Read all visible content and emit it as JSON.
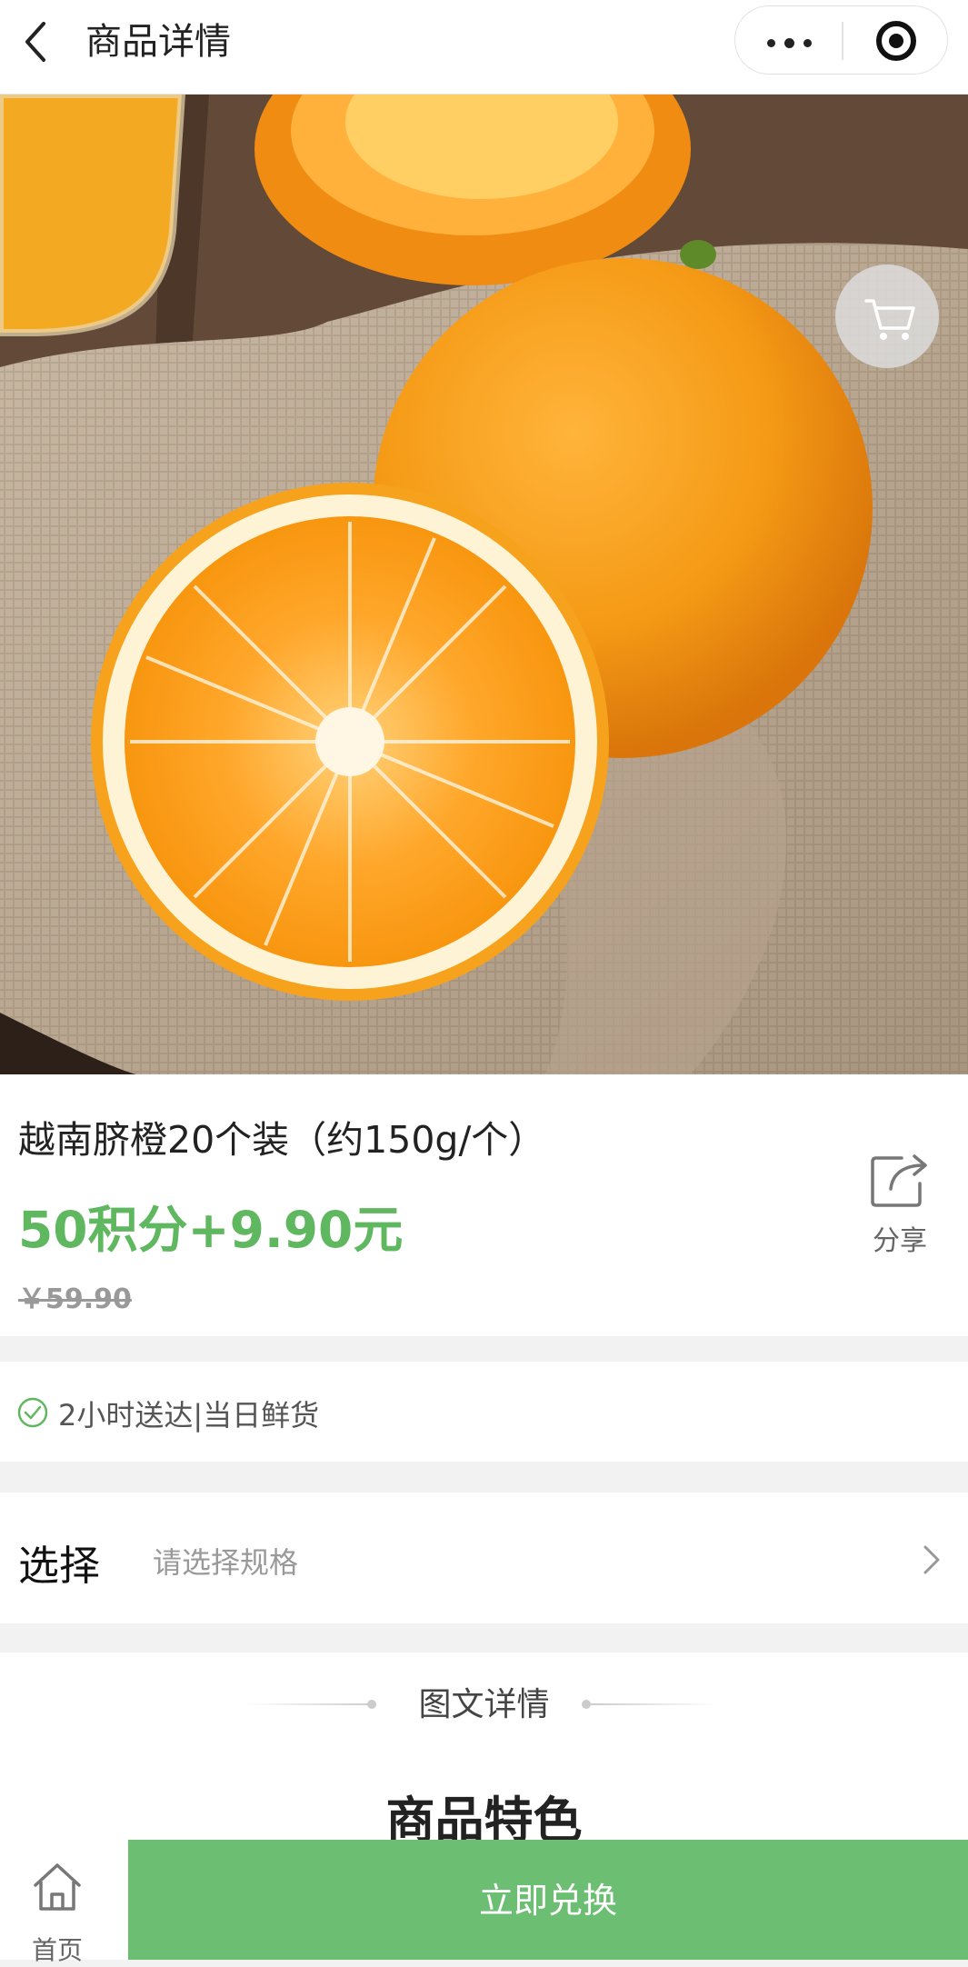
{
  "nav": {
    "title": "商品详情"
  },
  "gallery": {
    "image_count": 3,
    "active_index": 0
  },
  "product": {
    "title": "越南脐橙20个装（约150g/个）",
    "price": "50积分+9.90元",
    "original_price": "￥59.90",
    "share_label": "分享"
  },
  "delivery": {
    "text": "2小时送达|当日鲜货"
  },
  "spec": {
    "label": "选择",
    "hint": "请选择规格"
  },
  "detail": {
    "section_title": "图文详情",
    "feature_title": "商品特色"
  },
  "bottom": {
    "home_label": "首页",
    "redeem_label": "立即兑换"
  },
  "colors": {
    "accent_green": "#5fb75f",
    "button_green": "#6bbe72",
    "dot_active": "#333a44",
    "dot_inactive": "#d8d8d8"
  },
  "icons": [
    "back-arrow-icon",
    "more-icon",
    "close-target-icon",
    "cart-icon",
    "share-icon",
    "check-circle-icon",
    "chevron-right-icon",
    "home-icon"
  ]
}
